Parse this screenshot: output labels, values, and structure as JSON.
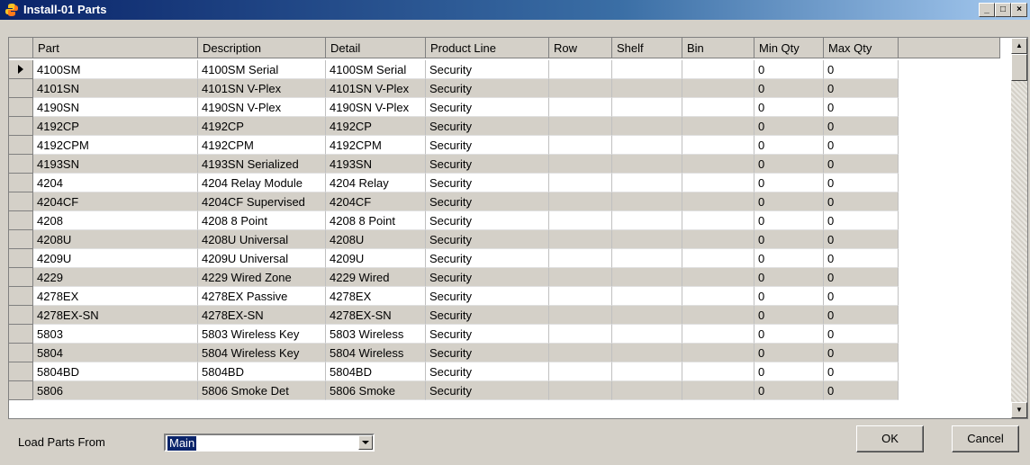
{
  "window": {
    "title": "Install-01 Parts",
    "controls": {
      "minimize": "_",
      "maximize": "□",
      "close": "×"
    }
  },
  "table": {
    "columns": [
      "Part",
      "Description",
      "Detail",
      "Product Line",
      "Row",
      "Shelf",
      "Bin",
      "Min Qty",
      "Max Qty"
    ],
    "rows": [
      [
        "4100SM",
        "4100SM Serial",
        "4100SM Serial",
        "Security",
        "",
        "",
        "",
        "0",
        "0"
      ],
      [
        "4101SN",
        "4101SN V-Plex",
        "4101SN V-Plex",
        "Security",
        "",
        "",
        "",
        "0",
        "0"
      ],
      [
        "4190SN",
        "4190SN V-Plex",
        "4190SN V-Plex",
        "Security",
        "",
        "",
        "",
        "0",
        "0"
      ],
      [
        "4192CP",
        "4192CP",
        "4192CP",
        "Security",
        "",
        "",
        "",
        "0",
        "0"
      ],
      [
        "4192CPM",
        "4192CPM",
        "4192CPM",
        "Security",
        "",
        "",
        "",
        "0",
        "0"
      ],
      [
        "4193SN",
        "4193SN Serialized",
        "4193SN",
        "Security",
        "",
        "",
        "",
        "0",
        "0"
      ],
      [
        "4204",
        "4204 Relay Module",
        "4204 Relay",
        "Security",
        "",
        "",
        "",
        "0",
        "0"
      ],
      [
        "4204CF",
        "4204CF Supervised",
        "4204CF",
        "Security",
        "",
        "",
        "",
        "0",
        "0"
      ],
      [
        "4208",
        "4208 8 Point",
        "4208 8 Point",
        "Security",
        "",
        "",
        "",
        "0",
        "0"
      ],
      [
        "4208U",
        "4208U Universal",
        "4208U",
        "Security",
        "",
        "",
        "",
        "0",
        "0"
      ],
      [
        "4209U",
        "4209U Universal",
        "4209U",
        "Security",
        "",
        "",
        "",
        "0",
        "0"
      ],
      [
        "4229",
        "4229 Wired Zone",
        "4229 Wired",
        "Security",
        "",
        "",
        "",
        "0",
        "0"
      ],
      [
        "4278EX",
        "4278EX Passive",
        "4278EX",
        "Security",
        "",
        "",
        "",
        "0",
        "0"
      ],
      [
        "4278EX-SN",
        "4278EX-SN",
        "4278EX-SN",
        "Security",
        "",
        "",
        "",
        "0",
        "0"
      ],
      [
        "5803",
        "5803 Wireless Key",
        "5803 Wireless",
        "Security",
        "",
        "",
        "",
        "0",
        "0"
      ],
      [
        "5804",
        "5804 Wireless Key",
        "5804 Wireless",
        "Security",
        "",
        "",
        "",
        "0",
        "0"
      ],
      [
        "5804BD",
        "5804BD",
        "5804BD",
        "Security",
        "",
        "",
        "",
        "0",
        "0"
      ],
      [
        "5806",
        "5806 Smoke Det",
        "5806 Smoke",
        "Security",
        "",
        "",
        "",
        "0",
        "0"
      ]
    ]
  },
  "footer": {
    "load_label": "Load Parts From",
    "load_value": "Main",
    "ok_label": "OK",
    "cancel_label": "Cancel"
  },
  "colors": {
    "title_start": "#0a246a",
    "title_end": "#a6caf0",
    "face": "#d4d0c8",
    "selection": "#0a246a"
  },
  "icons": {
    "app": "python-app-icon",
    "scroll_up": "scroll-up-arrow-icon",
    "scroll_down": "scroll-down-arrow-icon",
    "combo": "dropdown-arrow-icon",
    "current_row": "row-pointer-icon"
  }
}
